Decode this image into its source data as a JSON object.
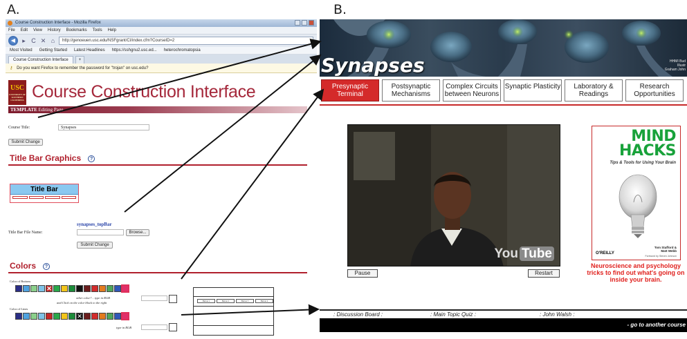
{
  "panel_labels": {
    "a": "A.",
    "b": "B."
  },
  "browser": {
    "window_title": "Course Construction Interface - Mozilla Firefox",
    "menu": [
      "File",
      "Edit",
      "View",
      "History",
      "Bookmarks",
      "Tools",
      "Help"
    ],
    "url": "http://genoeuen.usc.edu/NSFgrant/CI/index.cfm?CourseID=2",
    "bookmarks": [
      "Most Visited",
      "Getting Started",
      "Latest Headlines",
      "https://sshgnu2.usc.ed...",
      "heterochromatopsia"
    ],
    "tabs": [
      "Course Construction Interface",
      "+"
    ],
    "password_prompt": "Do you want Firefox to remember the password for \"trojan\" on usc.edu?"
  },
  "cci": {
    "logo_text": "USC",
    "logo_sub": "UNIVERSITY OF SOUTHERN CALIFORNIA",
    "title": "Course Construction Interface",
    "template_label": "TEMPLATE",
    "editing_label": "Editing Page",
    "course_title_label": "Course Title:",
    "course_title_value": "Synapses",
    "submit_change": "Submit Change",
    "title_bar_graphics_heading": "Title Bar Graphics",
    "help_glyph": "?",
    "title_bar_preview": "Title Bar",
    "title_bar_file_label": "Title Bar File Name:",
    "title_bar_file_value": "synapses_topBar",
    "browse": "Browse...",
    "colors_heading": "Colors",
    "color_of_buttons": "Color of Buttons",
    "other_color_text": "other color? .. type in RGB",
    "click_color_text": "and Click on the color block to the right",
    "color_of_lines": "Color of Lines",
    "type_in_rgb": "type in RGB",
    "preview_buttons": [
      "Button 1",
      "Button 2",
      "Button 3",
      "Button 4"
    ]
  },
  "swatch_colors": {
    "buttons": [
      "#2b2e86",
      "#4fa3e0",
      "#8bd08b",
      "#7ec3e8",
      "#c62828",
      "#29a84a",
      "#f3c51a",
      "#1c8b3a",
      "#111111",
      "#6b1d1d",
      "#d22b2b",
      "#e37b1e",
      "#4fa65b",
      "#3158b8",
      "#e0306a"
    ],
    "lines": [
      "#2b2e86",
      "#4fa3e0",
      "#8bd08b",
      "#7ec3e8",
      "#c62828",
      "#29a84a",
      "#f3c51a",
      "#1c8b3a",
      "#111111",
      "#6b1d1d",
      "#d22b2b",
      "#e37b1e",
      "#4fa65b",
      "#3158b8",
      "#e0306a"
    ]
  },
  "site": {
    "title": "Synapses",
    "credit_lines": [
      "HHMI Bud",
      "Illustr",
      "Graham John"
    ],
    "nav": [
      "Presynaptic Terminal",
      "Postsynaptic Mechanisms",
      "Complex Circuits between Neurons",
      "Synaptic Plasticity",
      "Laboratory & Readings",
      "Research Opportunities"
    ],
    "youtube_you": "You",
    "youtube_tube": "Tube",
    "pause": "Pause",
    "restart": "Restart",
    "book_title_1": "MIND",
    "book_title_2": "HACKS",
    "book_subtitle": "Tips & Tools for Using Your Brain",
    "book_publisher": "O'REILLY",
    "book_authors": [
      "Tom Stafford &",
      "Matt Webb"
    ],
    "book_foreword": "Foreword by Steven Johnson",
    "book_caption": "Neuroscience and psychology tricks to find out what's going on inside your brain.",
    "footer_links": [
      ": Discussion Board :",
      ": Main Topic Quiz :",
      ": John Walsh :"
    ],
    "footer_bar_text": "- go to another course",
    "accent_red": "#c62828",
    "active_nav_color": "#d42a2a"
  }
}
